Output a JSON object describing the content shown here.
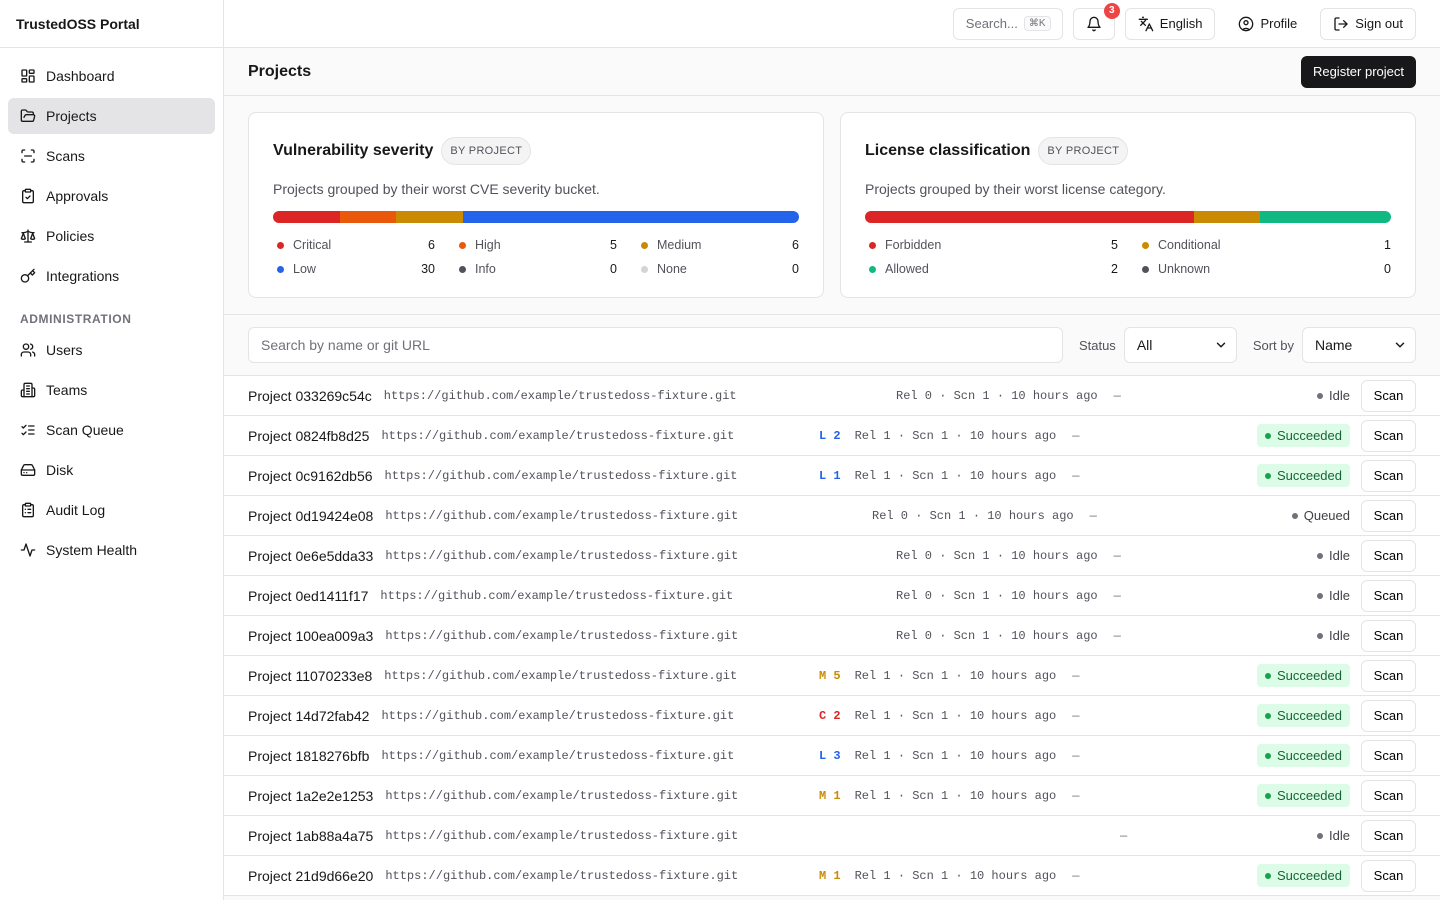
{
  "app": {
    "title": "TrustedOSS Portal"
  },
  "nav": {
    "items": [
      {
        "label": "Dashboard",
        "icon": "dashboard-icon"
      },
      {
        "label": "Projects",
        "icon": "folder-icon",
        "active": true
      },
      {
        "label": "Scans",
        "icon": "scan-icon"
      },
      {
        "label": "Approvals",
        "icon": "clipboard-check-icon"
      },
      {
        "label": "Policies",
        "icon": "scale-icon"
      },
      {
        "label": "Integrations",
        "icon": "key-icon"
      }
    ],
    "admin_label": "ADMINISTRATION",
    "admin_items": [
      {
        "label": "Users",
        "icon": "users-icon"
      },
      {
        "label": "Teams",
        "icon": "building-icon"
      },
      {
        "label": "Scan Queue",
        "icon": "list-checks-icon"
      },
      {
        "label": "Disk",
        "icon": "hard-drive-icon"
      },
      {
        "label": "Audit Log",
        "icon": "clipboard-list-icon"
      },
      {
        "label": "System Health",
        "icon": "activity-icon"
      }
    ]
  },
  "topbar": {
    "search_placeholder": "Search...",
    "search_shortcut": "⌘K",
    "notifications_count": "3",
    "language": "English",
    "profile": "Profile",
    "sign_out": "Sign out"
  },
  "page": {
    "title": "Projects",
    "register_button": "Register project"
  },
  "cards": {
    "vulnerability": {
      "title": "Vulnerability severity",
      "pill": "BY PROJECT",
      "description": "Projects grouped by their worst CVE severity bucket.",
      "buckets": [
        {
          "label": "Critical",
          "value": 6,
          "color": "#dc2626"
        },
        {
          "label": "High",
          "value": 5,
          "color": "#ea580c"
        },
        {
          "label": "Medium",
          "value": 6,
          "color": "#ca8a04"
        },
        {
          "label": "Low",
          "value": 30,
          "color": "#2563eb"
        },
        {
          "label": "Info",
          "value": 0,
          "color": "#52525b"
        },
        {
          "label": "None",
          "value": 0,
          "color": "#d4d4d8"
        }
      ]
    },
    "license": {
      "title": "License classification",
      "pill": "BY PROJECT",
      "description": "Projects grouped by their worst license category.",
      "buckets": [
        {
          "label": "Forbidden",
          "value": 5,
          "color": "#dc2626"
        },
        {
          "label": "Conditional",
          "value": 1,
          "color": "#ca8a04"
        },
        {
          "label": "Allowed",
          "value": 2,
          "color": "#10b981"
        },
        {
          "label": "Unknown",
          "value": 0,
          "color": "#52525b"
        }
      ]
    }
  },
  "filters": {
    "search_placeholder": "Search by name or git URL",
    "status_label": "Status",
    "status_value": "All",
    "sort_label": "Sort by",
    "sort_value": "Name"
  },
  "severity_colors": {
    "L": "#2563eb",
    "M": "#ca8a04",
    "C": "#dc2626"
  },
  "scan_label": "Scan",
  "projects": [
    {
      "name": "Project 033269c54c",
      "url": "https://github.com/example/trustedoss-fixture.git",
      "sev": "",
      "meta": "Rel 0 · Scn 1 · 10 hours ago",
      "dash": "—",
      "status": "Idle"
    },
    {
      "name": "Project 0824fb8d25",
      "url": "https://github.com/example/trustedoss-fixture.git",
      "sev": "L 2",
      "meta": "Rel 1 · Scn 1 · 10 hours ago",
      "dash": "—",
      "status": "Succeeded"
    },
    {
      "name": "Project 0c9162db56",
      "url": "https://github.com/example/trustedoss-fixture.git",
      "sev": "L 1",
      "meta": "Rel 1 · Scn 1 · 10 hours ago",
      "dash": "—",
      "status": "Succeeded"
    },
    {
      "name": "Project 0d19424e08",
      "url": "https://github.com/example/trustedoss-fixture.git",
      "sev": "",
      "meta": "Rel 0 · Scn 1 · 10 hours ago",
      "dash": "—",
      "status": "Queued"
    },
    {
      "name": "Project 0e6e5dda33",
      "url": "https://github.com/example/trustedoss-fixture.git",
      "sev": "",
      "meta": "Rel 0 · Scn 1 · 10 hours ago",
      "dash": "—",
      "status": "Idle"
    },
    {
      "name": "Project 0ed1411f17",
      "url": "https://github.com/example/trustedoss-fixture.git",
      "sev": "",
      "meta": "Rel 0 · Scn 1 · 10 hours ago",
      "dash": "—",
      "status": "Idle"
    },
    {
      "name": "Project 100ea009a3",
      "url": "https://github.com/example/trustedoss-fixture.git",
      "sev": "",
      "meta": "Rel 0 · Scn 1 · 10 hours ago",
      "dash": "—",
      "status": "Idle"
    },
    {
      "name": "Project 11070233e8",
      "url": "https://github.com/example/trustedoss-fixture.git",
      "sev": "M 5",
      "meta": "Rel 1 · Scn 1 · 10 hours ago",
      "dash": "—",
      "status": "Succeeded"
    },
    {
      "name": "Project 14d72fab42",
      "url": "https://github.com/example/trustedoss-fixture.git",
      "sev": "C 2",
      "meta": "Rel 1 · Scn 1 · 10 hours ago",
      "dash": "—",
      "status": "Succeeded"
    },
    {
      "name": "Project 1818276bfb",
      "url": "https://github.com/example/trustedoss-fixture.git",
      "sev": "L 3",
      "meta": "Rel 1 · Scn 1 · 10 hours ago",
      "dash": "—",
      "status": "Succeeded"
    },
    {
      "name": "Project 1a2e2e1253",
      "url": "https://github.com/example/trustedoss-fixture.git",
      "sev": "M 1",
      "meta": "Rel 1 · Scn 1 · 10 hours ago",
      "dash": "—",
      "status": "Succeeded"
    },
    {
      "name": "Project 1ab88a4a75",
      "url": "https://github.com/example/trustedoss-fixture.git",
      "sev": "",
      "meta": "",
      "dash": "—",
      "status": "Idle"
    },
    {
      "name": "Project 21d9d66e20",
      "url": "https://github.com/example/trustedoss-fixture.git",
      "sev": "M 1",
      "meta": "Rel 1 · Scn 1 · 10 hours ago",
      "dash": "—",
      "status": "Succeeded"
    }
  ]
}
